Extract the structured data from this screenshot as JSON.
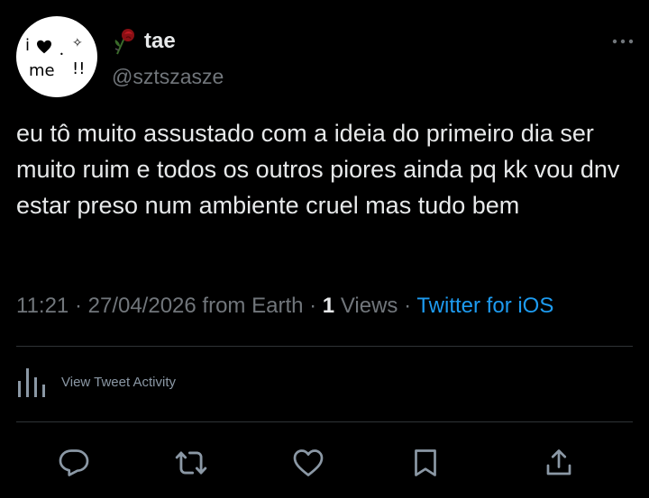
{
  "avatar": {
    "line1_left": "i",
    "line1_right": "✧",
    "line2_left": "me",
    "line2_right": "!!"
  },
  "user": {
    "display_name": "tae",
    "handle": "@sztszasze"
  },
  "tweet": {
    "text": "eu tô muito assustado com a ideia do primeiro dia ser muito ruim e todos os outros piores ainda pq kk vou dnv estar preso num ambiente cruel mas tudo bem",
    "time": "11:21",
    "date": "27/04/2026",
    "location": "from Earth",
    "views_count": "1",
    "views_label": "Views",
    "source": "Twitter for iOS",
    "separator": "·"
  },
  "activity": {
    "label": "View Tweet Activity"
  },
  "actions": [
    "reply-icon",
    "retweet-icon",
    "like-icon",
    "bookmark-icon",
    "share-icon"
  ],
  "colors": {
    "background": "#000000",
    "text": "#e7e9ea",
    "muted": "#71767b",
    "link": "#1d9bf0",
    "divider": "#2f3336",
    "heart": "#e0245e"
  }
}
